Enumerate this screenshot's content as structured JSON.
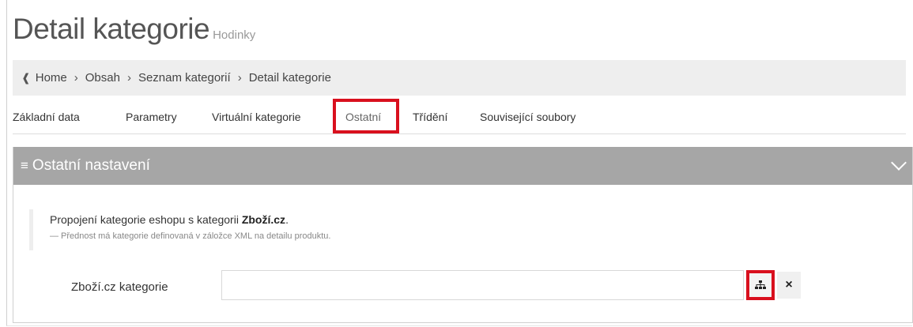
{
  "page": {
    "title": "Detail kategorie",
    "subtitle": "Hodinky"
  },
  "breadcrumb": {
    "home_icon": "home-icon",
    "separator": "›",
    "items": [
      "Home",
      "Obsah",
      "Seznam kategorií",
      "Detail kategorie"
    ]
  },
  "tabs": [
    {
      "label": "Základní data"
    },
    {
      "label": "Parametry"
    },
    {
      "label": "Virtuální kategorie"
    },
    {
      "label": "Ostatní",
      "active": true
    },
    {
      "label": "Třídění"
    },
    {
      "label": "Související soubory"
    }
  ],
  "panel": {
    "title": "Ostatní nastavení",
    "note_text_before": "Propojení kategorie eshopu s kategorii ",
    "note_bold": "Zboží.cz",
    "note_text_after": ".",
    "note_hint": "— Přednost má kategorie definovaná v záložce XML na detailu produktu.",
    "field_label": "Zboží.cz kategorie",
    "field_value": "",
    "clear_symbol": "×"
  },
  "colors": {
    "highlight": "#d9101e",
    "panel_header": "#a6a6a6",
    "breadcrumb_bg": "#eeeeee"
  }
}
